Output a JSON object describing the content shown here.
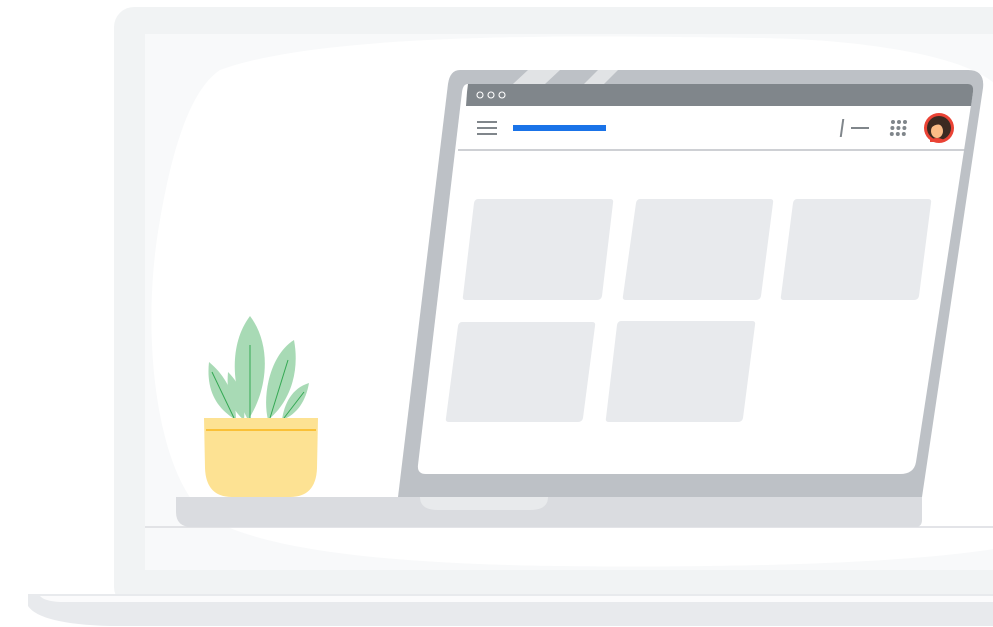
{
  "scene": {
    "kind": "illustration",
    "browser_window": {
      "titlebar_dots": 3,
      "toolbar": {
        "menu_icon": "hamburger-menu-icon",
        "add_icon": "plus-icon",
        "apps_icon": "apps-grid-icon",
        "account_icon": "account-avatar-icon"
      },
      "content_cards": 5
    },
    "decor": [
      "plant-pot",
      "laptop-base"
    ]
  },
  "colors": {
    "page_bg": "#ffffff",
    "outer_laptop_lid": "#f1f3f4",
    "screen_bg": "#f8f9fa",
    "blob": "#ffffff",
    "inner_laptop_frame": "#bdc1c6",
    "titlebar": "#80868b",
    "window_bg": "#ffffff",
    "card": "#e8eaed",
    "accent_bar": "#1a73e8",
    "icon_gray": "#80868b",
    "avatar_ring": "#ea4335",
    "avatar_hair": "#3c2a21",
    "avatar_face": "#fbbc86",
    "plant_leaf": "#a8dab5",
    "plant_vein": "#34a853",
    "pot": "#fde293",
    "pot_line": "#f9ab00",
    "base_plate": "#dadce0",
    "outer_base": "#e8eaed"
  }
}
